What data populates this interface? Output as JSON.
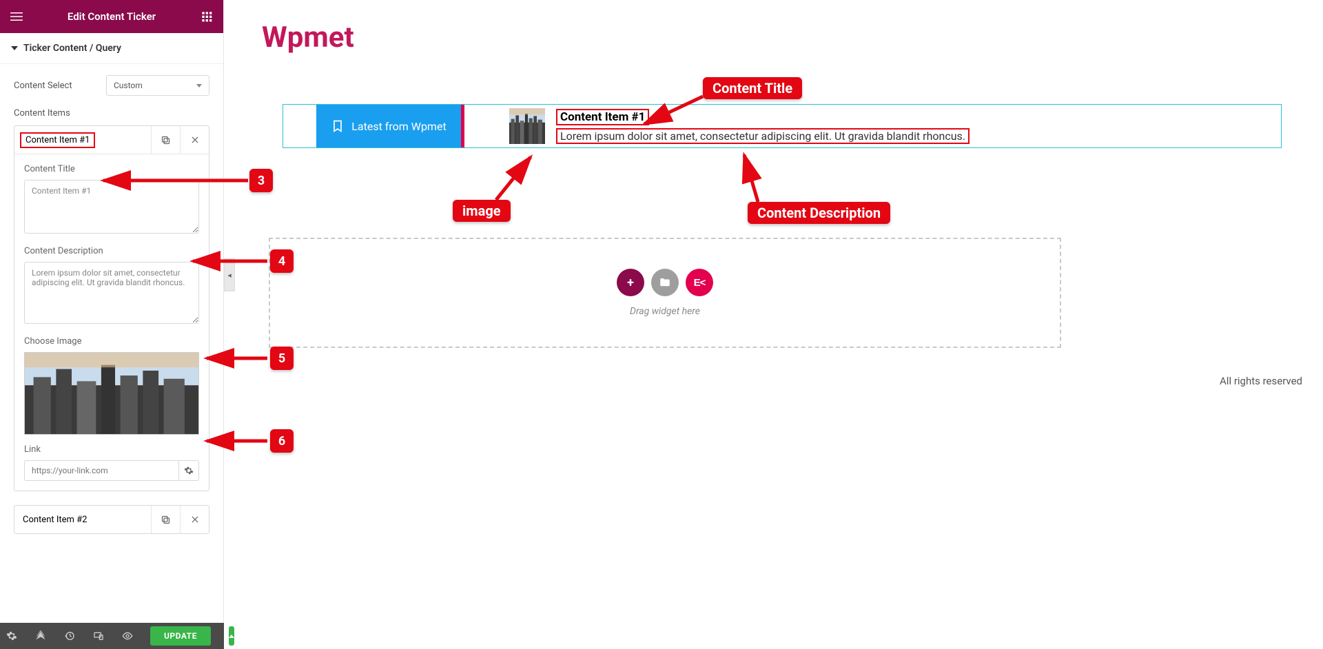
{
  "sidebar": {
    "header_title": "Edit Content Ticker",
    "section_title": "Ticker Content / Query",
    "content_select_label": "Content Select",
    "content_select_value": "Custom",
    "content_items_label": "Content Items",
    "item1": {
      "title": "Content Item #1",
      "fields": {
        "content_title_label": "Content Title",
        "content_title_value": "Content Item #1",
        "content_description_label": "Content Description",
        "content_description_value": "Lorem ipsum dolor sit amet, consectetur adipiscing elit. Ut gravida blandit rhoncus.",
        "choose_image_label": "Choose Image",
        "link_label": "Link",
        "link_placeholder": "https://your-link.com"
      }
    },
    "item2": {
      "title": "Content Item #2"
    }
  },
  "footer": {
    "update_label": "UPDATE"
  },
  "canvas": {
    "brand": "Wpmet",
    "ticker_label": "Latest from Wpmet",
    "ticker_title": "Content Item #1",
    "ticker_desc": "Lorem ipsum dolor sit amet, consectetur adipiscing elit. Ut gravida blandit rhoncus.",
    "dropzone_hint": "Drag widget here",
    "footer_text": "All rights reserved"
  },
  "annotations": {
    "content_title_badge": "Content Title",
    "image_badge": "image",
    "content_desc_badge": "Content Description",
    "n3": "3",
    "n4": "4",
    "n5": "5",
    "n6": "6"
  }
}
